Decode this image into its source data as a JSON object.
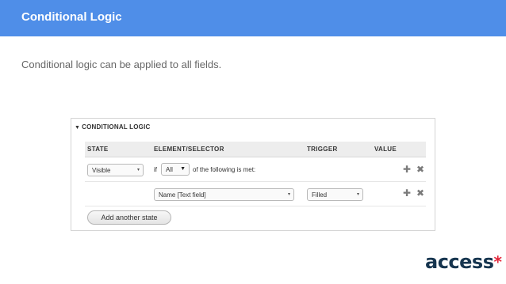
{
  "header": {
    "title": "Conditional Logic"
  },
  "intro": "Conditional logic can be applied to all fields.",
  "panel": {
    "legend": "CONDITIONAL LOGIC",
    "columns": [
      "STATE",
      "ELEMENT/SELECTOR",
      "TRIGGER",
      "VALUE"
    ],
    "row1": {
      "state": "Visible",
      "if_label": "if",
      "match": "All",
      "suffix": "of the following is met:"
    },
    "row2": {
      "selector": "Name [Text field]",
      "trigger": "Filled"
    },
    "add_button": "Add another state"
  },
  "logo": {
    "text": "access",
    "mark": "*"
  },
  "colors": {
    "header_bg": "#4f8ee8",
    "logo_text": "#16354f",
    "logo_star": "#e3263a"
  }
}
